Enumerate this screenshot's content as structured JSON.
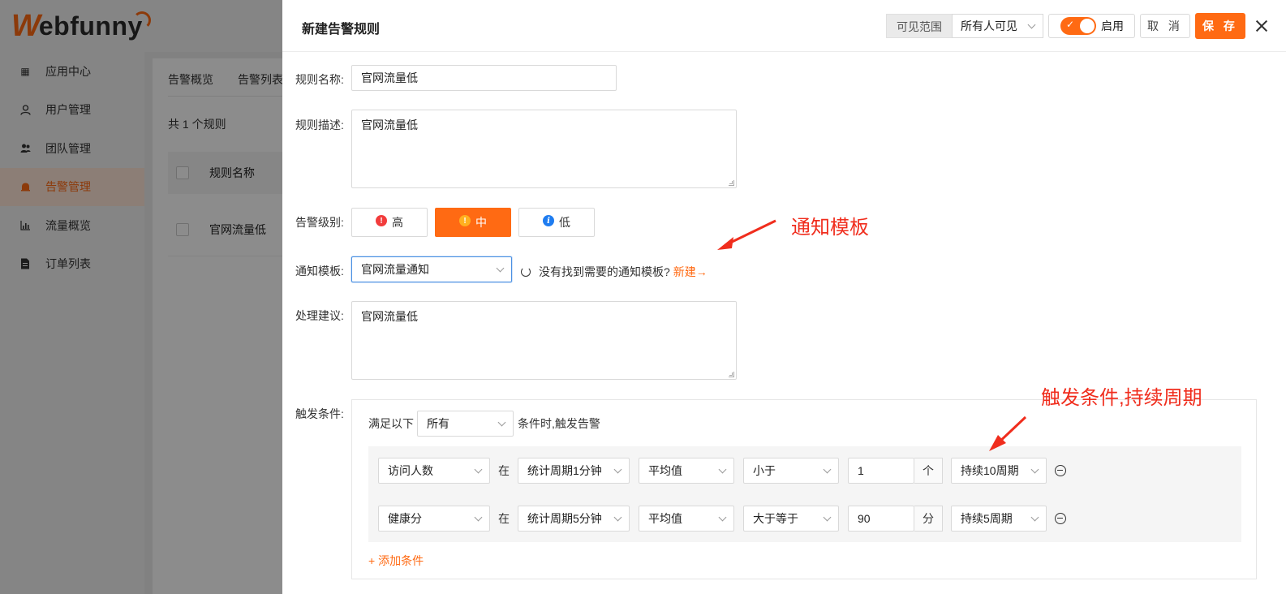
{
  "bg": {
    "logo_w": "W",
    "logo_rest": "ebfunny",
    "nav": [
      {
        "label": "应用中心",
        "icon": "grid-icon",
        "active": false
      },
      {
        "label": "用户管理",
        "icon": "user-icon",
        "active": false
      },
      {
        "label": "团队管理",
        "icon": "team-icon",
        "active": false
      },
      {
        "label": "告警管理",
        "icon": "bell-icon",
        "active": true
      },
      {
        "label": "流量概览",
        "icon": "bar-chart-icon",
        "active": false
      },
      {
        "label": "订单列表",
        "icon": "document-icon",
        "active": false
      }
    ],
    "tabs": [
      "告警概览",
      "告警列表"
    ],
    "count": "共 1 个规则",
    "col_header": "规则名称",
    "row_name": "官网流量低"
  },
  "drawer": {
    "title": "新建告警规则",
    "visibility_label": "可见范围",
    "visibility_value": "所有人可见",
    "toggle_label": "启用",
    "cancel_label": "取 消",
    "save_label": "保 存"
  },
  "form": {
    "name_label": "规则名称:",
    "name_value": "官网流量低",
    "desc_label": "规则描述:",
    "desc_value": "官网流量低",
    "level_label": "告警级别:",
    "levels": [
      {
        "label": "高",
        "mark": "!",
        "active": false
      },
      {
        "label": "中",
        "mark": "!",
        "active": true
      },
      {
        "label": "低",
        "mark": "i",
        "active": false
      }
    ],
    "template_label": "通知模板:",
    "template_value": "官网流量通知",
    "template_hint": "没有找到需要的通知模板?",
    "template_new": "新建→",
    "advice_label": "处理建议:",
    "advice_value": "官网流量低",
    "trigger_label": "触发条件:",
    "trigger_prefix": "满足以下",
    "trigger_match": "所有",
    "trigger_suffix": "条件时,触发告警",
    "conditions": [
      {
        "metric": "访问人数",
        "in": "在",
        "period": "统计周期1分钟",
        "agg": "平均值",
        "op": "小于",
        "value": "1",
        "unit": "个",
        "duration": "持续10周期"
      },
      {
        "metric": "健康分",
        "in": "在",
        "period": "统计周期5分钟",
        "agg": "平均值",
        "op": "大于等于",
        "value": "90",
        "unit": "分",
        "duration": "持续5周期"
      }
    ],
    "add_condition": "+ 添加条件"
  },
  "annotations": {
    "template_note": "通知模板",
    "trigger_note": "触发条件,持续周期",
    "color": "#f02d1d"
  },
  "colors": {
    "accent": "#ff6a13"
  }
}
